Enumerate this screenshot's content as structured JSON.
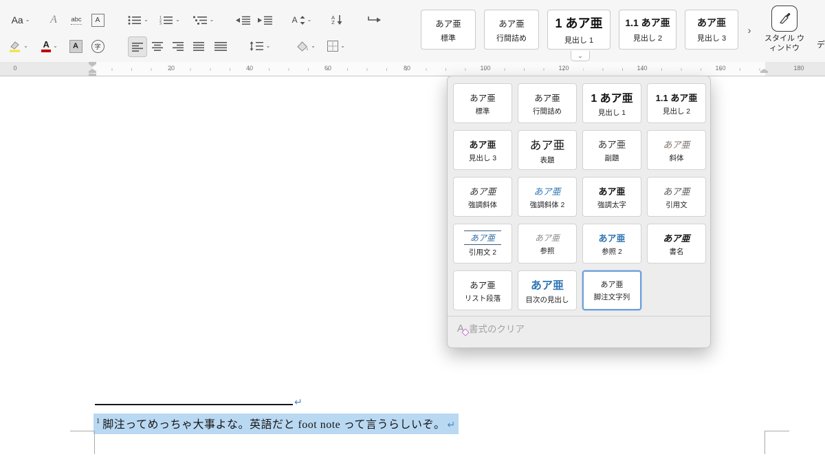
{
  "colors": {
    "style_blue": "#2e74b5",
    "selection_highlight": "#b9d8f2",
    "highlighter_yellow": "#f5e13c",
    "font_color_red": "#c00000",
    "selected_chip_border": "#6f9fd8"
  },
  "toolbar": {
    "change_case_label": "Aa",
    "dropdown_chevron": "⌄",
    "text_effect_glyph": "A",
    "phonetic_glyph": "abc",
    "char_border_glyph": "A",
    "sort_letter": "A",
    "sort_az_top": "A",
    "sort_az_bottom": "Z",
    "font_color_glyph": "A",
    "char_shading_glyph": "A",
    "enclose_glyph": "字"
  },
  "ribbon_gallery": {
    "items": [
      {
        "preview": "あア亜",
        "label": "標準"
      },
      {
        "preview": "あア亜",
        "label": "行間詰め"
      },
      {
        "preview": "1 あア亜",
        "label": "見出し 1"
      },
      {
        "preview": "1.1 あア亜",
        "label": "見出し 2"
      },
      {
        "preview": "あア亜",
        "label": "見出し 3"
      }
    ],
    "more_chevron": "›",
    "expand_chevron": "⌄",
    "style_window_label": "スタイル ウィンドウ",
    "clipped_right_label": "デ"
  },
  "styles_panel": {
    "items": [
      {
        "preview": "あア亜",
        "label": "標準"
      },
      {
        "preview": "あア亜",
        "label": "行間詰め"
      },
      {
        "preview": "1 あア亜",
        "label": "見出し 1"
      },
      {
        "preview": "1.1 あア亜",
        "label": "見出し 2"
      },
      {
        "preview": "あア亜",
        "label": "見出し 3"
      },
      {
        "preview": "あア亜",
        "label": "表題"
      },
      {
        "preview": "あア亜",
        "label": "副題"
      },
      {
        "preview": "あア亜",
        "label": "斜体"
      },
      {
        "preview": "あア亜",
        "label": "強調斜体"
      },
      {
        "preview": "あア亜",
        "label": "強調斜体 2"
      },
      {
        "preview": "あア亜",
        "label": "強調太字"
      },
      {
        "preview": "あア亜",
        "label": "引用文"
      },
      {
        "preview": "あア亜",
        "label": "引用文 2"
      },
      {
        "preview": "あア亜",
        "label": "参照"
      },
      {
        "preview": "あア亜",
        "label": "参照 2"
      },
      {
        "preview": "あア亜",
        "label": "書名"
      },
      {
        "preview": "あア亜",
        "label": "リスト段落"
      },
      {
        "preview": "あア亜",
        "label": "目次の見出し"
      },
      {
        "preview": "あア亜",
        "label": "脚注文字列"
      }
    ],
    "selected_label": "脚注文字列",
    "clear_formatting_label": "書式のクリア",
    "clear_formatting_glyph": "A"
  },
  "ruler": {
    "numbers": [
      "0",
      "20",
      "40",
      "60",
      "80",
      "100",
      "120",
      "140",
      "160",
      "180"
    ]
  },
  "document": {
    "footnote_reference": "1",
    "footnote_text": "脚注ってめっちゃ大事よな。英語だと foot note って言うらしいぞ。",
    "return_mark": "↵"
  }
}
